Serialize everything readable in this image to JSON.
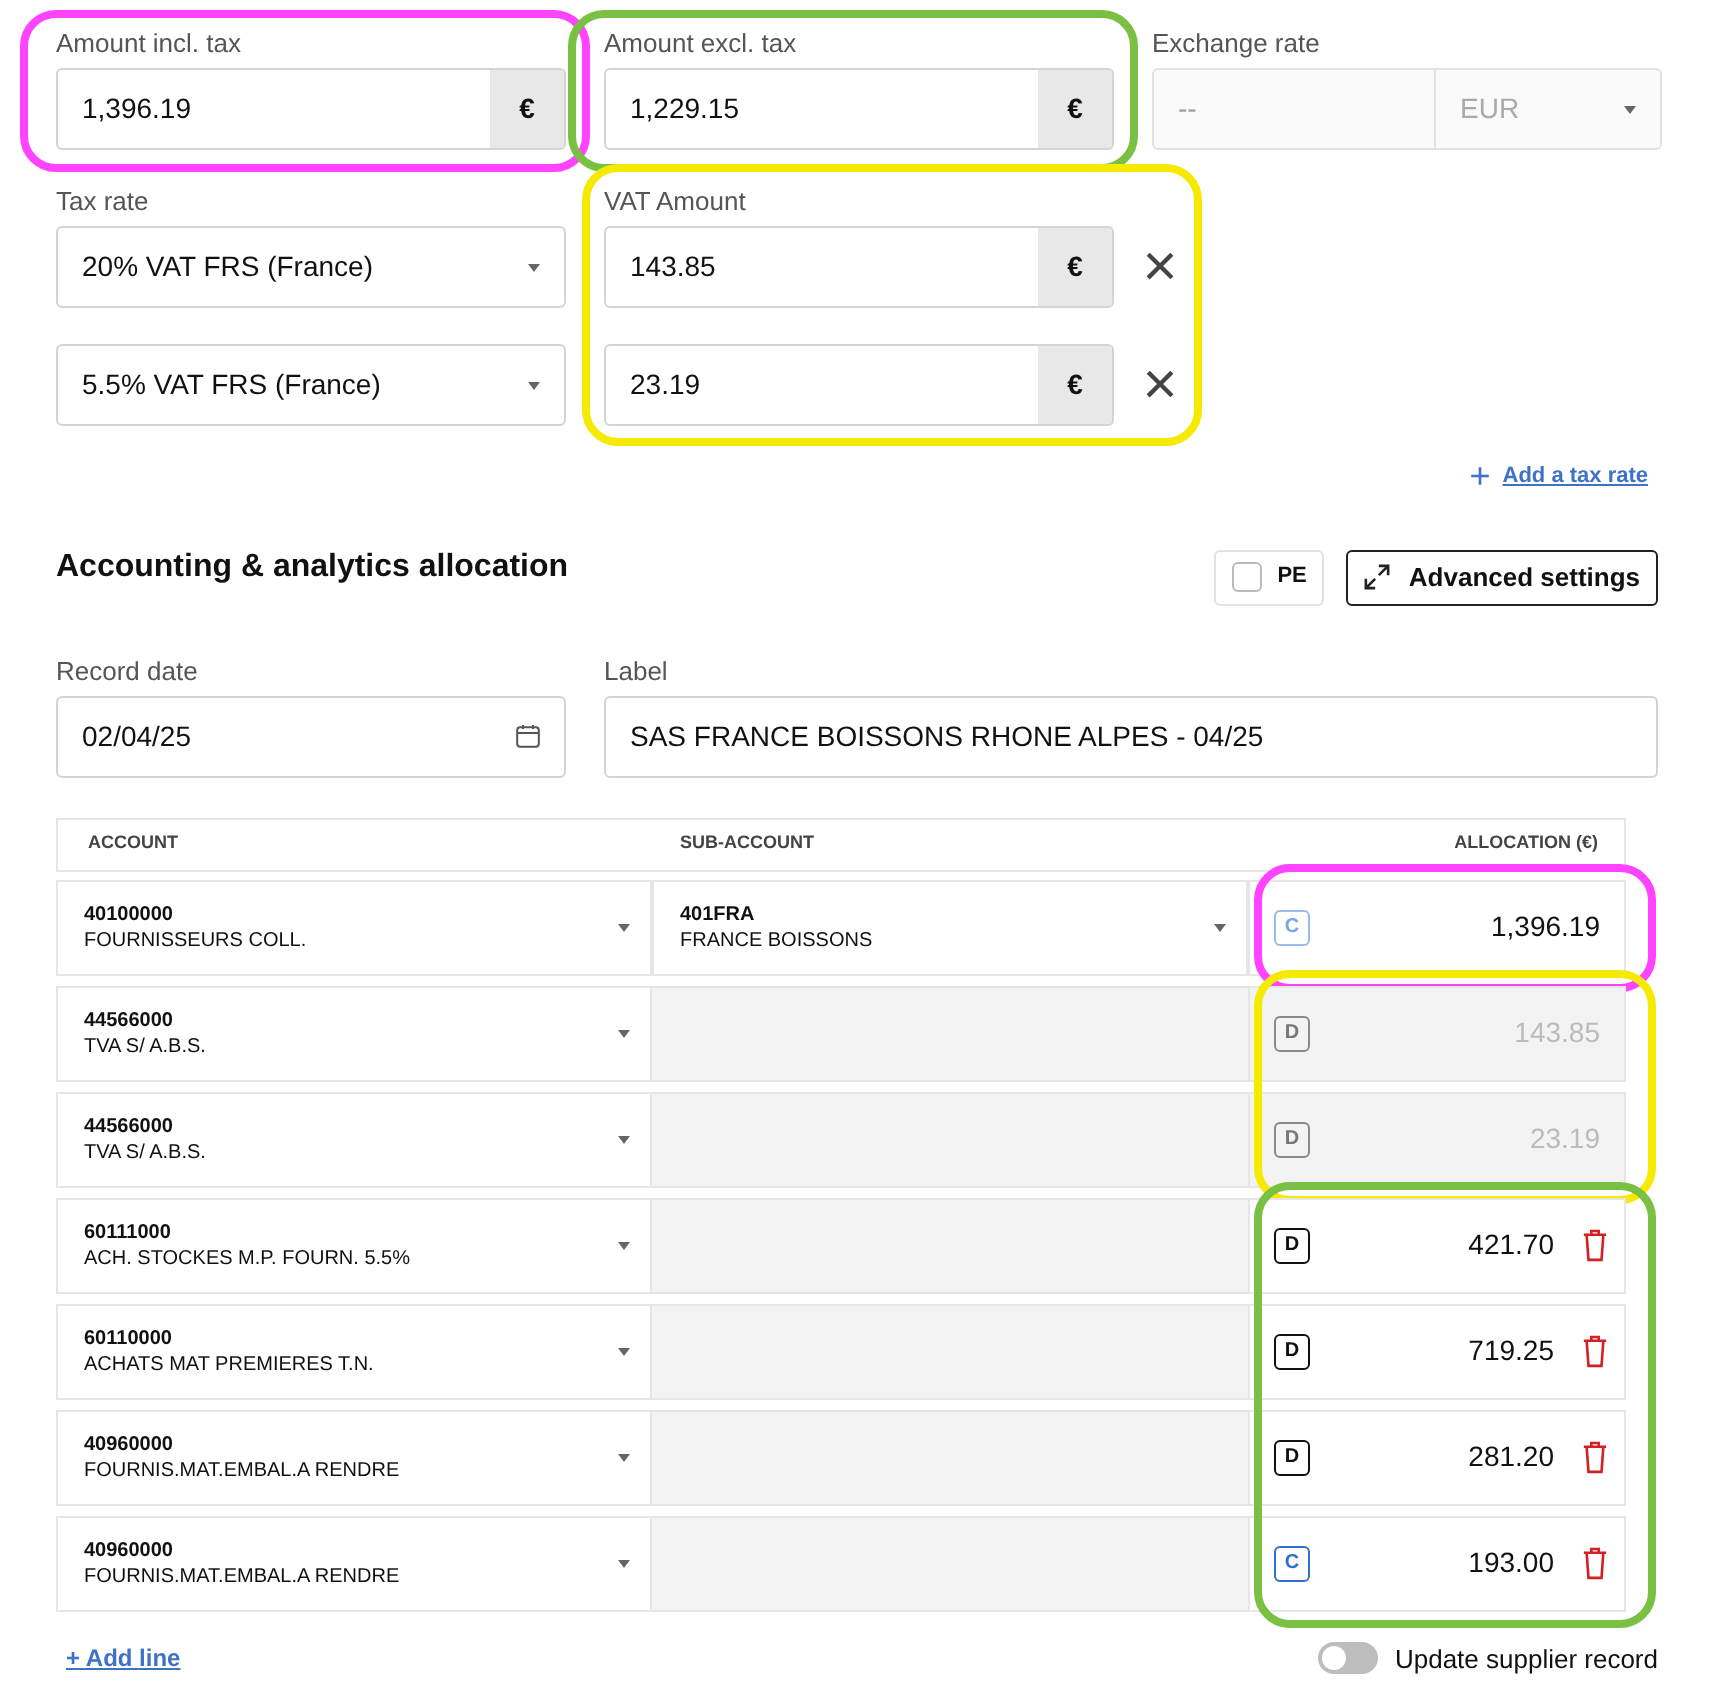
{
  "amounts": [
    {
      "label": "Amount incl. tax",
      "value": "1,396.19",
      "currency": "€",
      "color": "#ff44ff"
    },
    {
      "label": "Amount excl. tax",
      "value": "1,229.15",
      "currency": "€",
      "color": "#7ac143"
    }
  ],
  "exchange_rate": {
    "label": "Exchange rate",
    "placeholder": "--",
    "currency": "EUR",
    "disabled": true
  },
  "taxes": {
    "rate_label": "Tax rate",
    "vat_label": "VAT Amount",
    "color": "#f5ea00",
    "rows": [
      {
        "rate": "20% VAT FRS (France)",
        "vat_amount": "143.85",
        "currency": "€",
        "remove": "×"
      },
      {
        "rate": "5.5% VAT FRS (France)",
        "vat_amount": "23.19",
        "currency": "€",
        "remove": "×"
      }
    ]
  },
  "add_tax_rate": {
    "icon": "+",
    "label": "Add a tax rate"
  },
  "allocation": {
    "title": "Accounting & analytics allocation",
    "pe_checkbox": {
      "label": "PE",
      "checked": false
    },
    "advanced_button": "Advanced settings",
    "record_date": {
      "label": "Record date",
      "value": "02/04/25"
    },
    "label_field": {
      "label": "Label",
      "value": "SAS FRANCE BOISSONS RHONE ALPES - 04/25"
    },
    "columns": [
      "ACCOUNT",
      "SUB-ACCOUNT",
      "ALLOCATION (€)"
    ],
    "rows": [
      {
        "account_code": "40100000",
        "account_name": "FOURNISSEURS COLL.",
        "sub_code": "401FRA",
        "sub_name": "FRANCE BOISSONS",
        "side": "C",
        "amount": "1,396.19",
        "locked": true,
        "disabled": false,
        "color": "#ff44ff"
      },
      {
        "account_code": "44566000",
        "account_name": "TVA S/ A.B.S.",
        "side": "D",
        "amount": "143.85",
        "locked": true,
        "disabled": true,
        "color": "#f5ea00"
      },
      {
        "account_code": "44566000",
        "account_name": "TVA S/ A.B.S.",
        "side": "D",
        "amount": "23.19",
        "locked": true,
        "disabled": true,
        "color": "#f5ea00"
      },
      {
        "account_code": "60111000",
        "account_name": "ACH. STOCKES M.P. FOURN. 5.5%",
        "side": "D",
        "amount": "421.70",
        "locked": false,
        "disabled": false,
        "color": "#7ac143"
      },
      {
        "account_code": "60110000",
        "account_name": "ACHATS MAT PREMIERES T.N.",
        "side": "D",
        "amount": "719.25",
        "locked": false,
        "disabled": false,
        "color": "#7ac143"
      },
      {
        "account_code": "40960000",
        "account_name": "FOURNIS.MAT.EMBAL.A RENDRE",
        "side": "D",
        "amount": "281.20",
        "locked": false,
        "disabled": false,
        "color": "#7ac143"
      },
      {
        "account_code": "40960000",
        "account_name": "FOURNIS.MAT.EMBAL.A RENDRE",
        "side": "C",
        "amount": "193.00",
        "locked": false,
        "disabled": false,
        "color": "#7ac143"
      }
    ],
    "add_line": "+ Add line",
    "update_supplier": {
      "label": "Update supplier record",
      "on": false
    }
  }
}
